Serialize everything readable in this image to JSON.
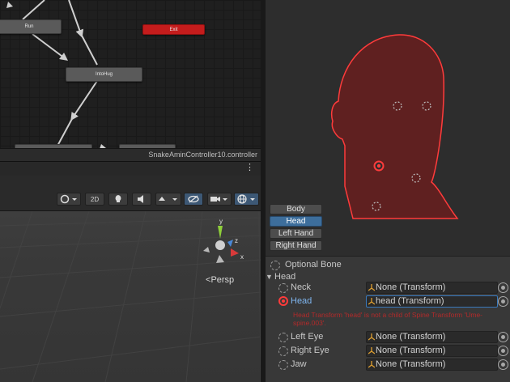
{
  "animator": {
    "states": [
      {
        "id": "run",
        "label": "Run"
      },
      {
        "id": "exit",
        "label": "Exit"
      },
      {
        "id": "intohug",
        "label": "IntoHug"
      }
    ],
    "filename": "SnakeAminController10.controller"
  },
  "scene": {
    "menu_dots": "⋮",
    "toolbar": {
      "mode_2d": "2D"
    },
    "gizmo_axes": {
      "x": "x",
      "y": "y",
      "z": "z"
    },
    "persp_label": "Persp"
  },
  "avatar": {
    "body_parts": [
      "Body",
      "Head",
      "Left Hand",
      "Right Hand"
    ],
    "selected_part": "Head"
  },
  "bones": {
    "optional_label": "Optional Bone",
    "section_label": "Head",
    "rows": [
      {
        "label": "Neck",
        "value": "None (Transform)"
      },
      {
        "label": "Head",
        "value": "head (Transform)"
      },
      {
        "label": "Left Eye",
        "value": "None (Transform)"
      },
      {
        "label": "Right Eye",
        "value": "None (Transform)"
      },
      {
        "label": "Jaw",
        "value": "None (Transform)"
      }
    ],
    "error": "Head Transform 'head' is not a child of Spine Transform 'Ume-spine.003'."
  },
  "colors": {
    "exit_state": "#c41c1c",
    "accent_blue": "#3d6e9c",
    "error_red": "#b32a2a",
    "mask_red": "#ff3b3b"
  }
}
